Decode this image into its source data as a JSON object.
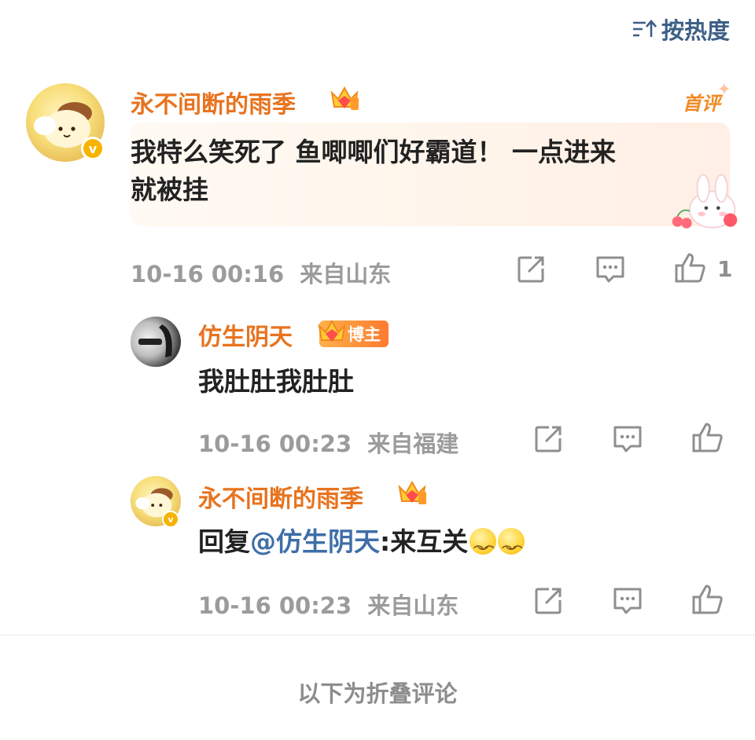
{
  "sort": {
    "label": "按热度",
    "icon": "sort-icon"
  },
  "comments": [
    {
      "username": "永不间断的雨季",
      "text_line1": "我特么笑死了 鱼唧唧们好霸道！ 一点进来",
      "text_line2": "就被挂",
      "badge": "首评",
      "time": "10-16 00:16",
      "location": "来自山东",
      "likes": "1",
      "verified_mark": "v"
    }
  ],
  "replies": [
    {
      "username": "仿生阴天",
      "badge": "博主",
      "text": "我肚肚我肚肚",
      "time": "10-16 00:23",
      "location": "来自福建"
    },
    {
      "username": "永不间断的雨季",
      "reply_prefix": "回复",
      "mention": "@仿生阴天",
      "text": ":来互关",
      "time": "10-16 00:23",
      "location": "来自山东",
      "verified_mark": "v"
    }
  ],
  "footer": {
    "folded_label": "以下为折叠评论"
  },
  "colors": {
    "username": "#e8731f",
    "mention": "#3f6ea8",
    "meta": "#9b9b9b",
    "sort": "#3d5f86"
  }
}
